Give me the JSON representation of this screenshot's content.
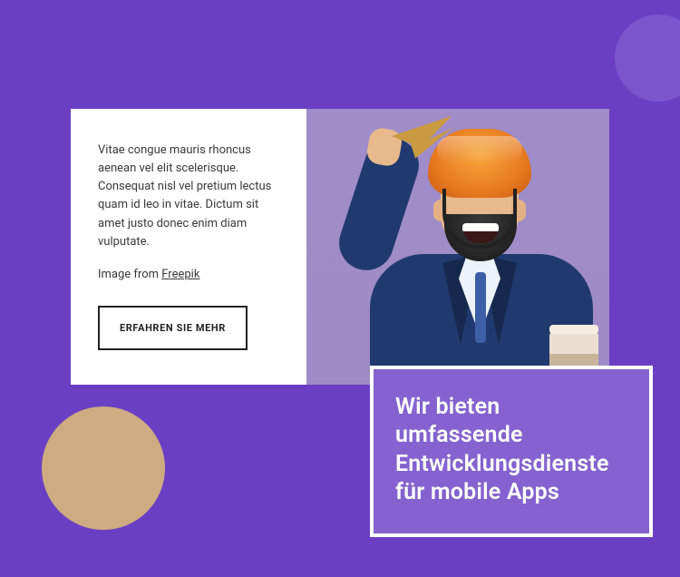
{
  "card": {
    "body": "Vitae congue mauris rhoncus aenean vel elit scelerisque. Consequat nisl vel pretium lectus quam id leo in vitae. Dictum sit amet justo donec enim diam vulputate.",
    "credit_prefix": "Image from ",
    "credit_link_text": "Freepik",
    "button_label": "ERFAHREN SIE MEHR"
  },
  "callout": {
    "headline": "Wir bieten umfassende Entwicklungsdienste für mobile Apps"
  }
}
